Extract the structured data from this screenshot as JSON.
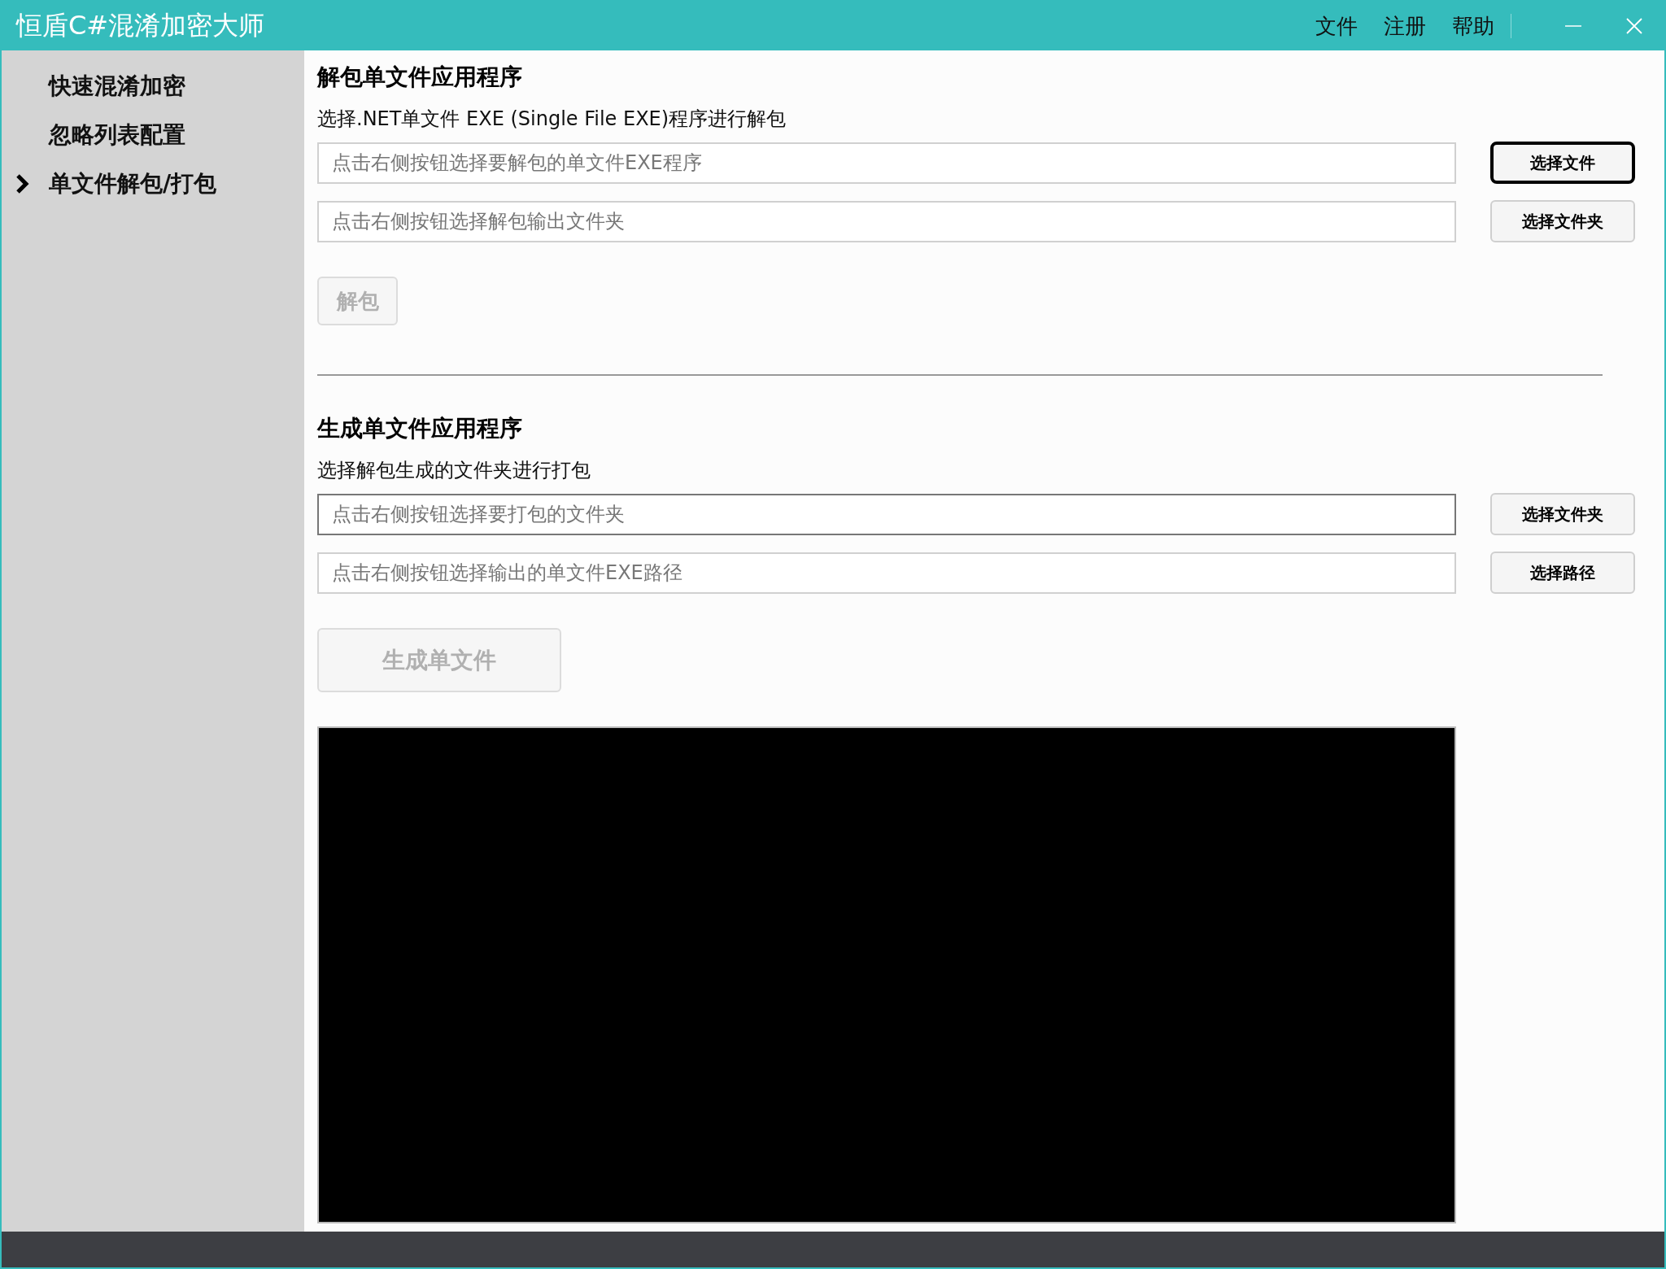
{
  "window": {
    "title": "恒盾C#混淆加密大师",
    "menu": [
      "文件",
      "注册",
      "帮助"
    ]
  },
  "sidebar": {
    "items": [
      {
        "label": "快速混淆加密",
        "selected": false
      },
      {
        "label": "忽略列表配置",
        "selected": false
      },
      {
        "label": "单文件解包/打包",
        "selected": true
      }
    ]
  },
  "sections": [
    {
      "title": "解包单文件应用程序",
      "description": "选择.NET单文件 EXE (Single File EXE)程序进行解包",
      "fields": [
        {
          "placeholder": "点击右侧按钮选择要解包的单文件EXE程序",
          "focused": false,
          "button": {
            "label": "选择文件",
            "focused": true
          }
        },
        {
          "placeholder": "点击右侧按钮选择解包输出文件夹",
          "focused": false,
          "button": {
            "label": "选择文件夹",
            "focused": false
          }
        }
      ],
      "action": {
        "label": "解包",
        "disabled": true
      }
    },
    {
      "title": "生成单文件应用程序",
      "description": "选择解包生成的文件夹进行打包",
      "fields": [
        {
          "placeholder": "点击右侧按钮选择要打包的文件夹",
          "focused": true,
          "button": {
            "label": "选择文件夹",
            "focused": false
          }
        },
        {
          "placeholder": "点击右侧按钮选择输出的单文件EXE路径",
          "focused": false,
          "button": {
            "label": "选择路径",
            "focused": false
          }
        }
      ],
      "action": {
        "label": "生成单文件",
        "disabled": true
      }
    }
  ],
  "console": {
    "visible": true
  }
}
